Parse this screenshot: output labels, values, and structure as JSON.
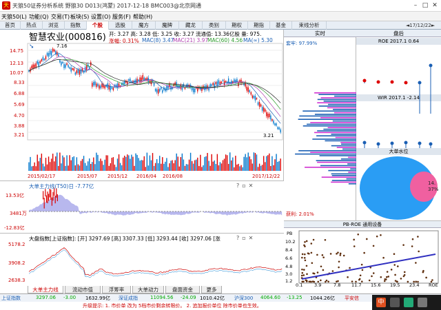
{
  "window": {
    "title": "天狼50证券分析系统 野狼30 D013(鸿蒙) 2017-12-18 BMC003@北京网通",
    "icon": "天"
  },
  "menu": [
    "天狼50(L)",
    "功能(Q)",
    "交易(T)",
    "板块(S)",
    "设置(O)",
    "服务(F)",
    "帮助(H)"
  ],
  "tabs": [
    "首页",
    "热点",
    "浏览",
    "指数",
    "个股",
    "选股",
    "魔方",
    "魔牌",
    "藏龙",
    "类别",
    "期权",
    "期指",
    "基金",
    "束线分析"
  ],
  "active_tab": "个股",
  "date_nav": "◄17/12/22►",
  "stock": {
    "name": "智慧农业(000816)",
    "line1": "开: 3.27 高: 3.28 低: 3.25 收: 3.27 流通值: 13.36亿股 量: 975.",
    "change": "涨幅: 0.31%",
    "mas": [
      "MAC(8) 3.47",
      "MAC(21) 3.97",
      "MAC(60) 4.56",
      "MA(∞) 5.30"
    ],
    "peak_label": "7.16",
    "low_label": "3.21",
    "yticks": [
      "14.75",
      "12.13",
      "10.07",
      "8.33",
      "6.88",
      "5.69",
      "4.70",
      "3.88",
      "3.21"
    ],
    "xticks": [
      "2015/02/17",
      "2015/07",
      "2015/12",
      "2016/04",
      "2016/08",
      "2017/12/22"
    ]
  },
  "flow": {
    "title": "大单主力线(T50)日 -7.77亿",
    "yticks": [
      "13.53亿",
      "3481万",
      "-12.83亿"
    ]
  },
  "index": {
    "title": "大盘指数[上证指数]: [开] 3297.69 [高] 3307.33 [低] 3293.44 [收] 3297.06 [涨",
    "yticks": [
      "5178.2",
      "3908.2",
      "2638.3"
    ]
  },
  "realtime": {
    "header": "实时",
    "ratio": "套牢: 97.99%",
    "profit": "获利: 2.01%"
  },
  "panhou": {
    "header": "盘后",
    "roe": "ROE 2017.1 0.64",
    "wir": "WIR 2017.1 -2.14"
  },
  "water": {
    "header": "大单水位",
    "value": "14.",
    "pct": "37%"
  },
  "scatter": {
    "title": "PB-ROE 通用设备",
    "ylabel": "PB",
    "yticks": [
      "10.2",
      "8.4",
      "6.6",
      "4.8",
      "3.0",
      "1.2"
    ],
    "xticks": [
      "0.1",
      "3.9",
      "7.8",
      "11.7",
      "15.6",
      "19.5",
      "23.4",
      "ROE"
    ]
  },
  "bottom_tabs": [
    "大单主力线",
    "流动市值",
    "浮筹率",
    "大单动力",
    "盘面资金",
    "更多"
  ],
  "status": {
    "items": [
      "上证指数",
      "3297.06",
      "-3.00",
      "1632.99亿",
      "深证成指",
      "11094.56",
      "-24.09",
      "1010.42亿",
      "沪深300",
      "4064.60",
      "-13.25",
      "1044.26亿"
    ],
    "right": "平安信"
  },
  "hint": "升级提示: 1. 市价单 改为 5档市价剩余转限价。 2. 追加报价单位 除市价单也生效。",
  "colors": {
    "up": "#d00000",
    "down": "#0070c0",
    "accent": "#1a5fb4"
  }
}
